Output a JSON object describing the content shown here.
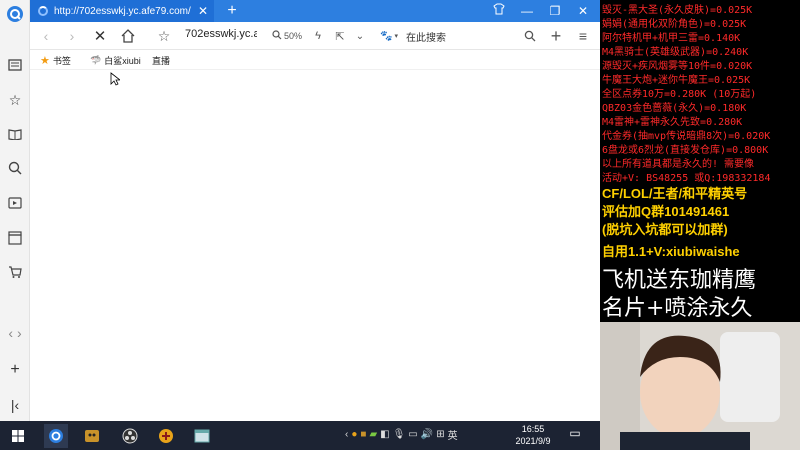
{
  "browser": {
    "tab": {
      "title": "http://702esswkj.yc.afe79.com/"
    },
    "address_text": "702esswkj.yc.a",
    "zoom_level": "50%",
    "search_placeholder": "在此搜索",
    "bookmarks": {
      "label": "书签",
      "items": [
        "白鲨xiubi",
        "直播"
      ]
    }
  },
  "taskbar": {
    "time": "16:55",
    "date": "2021/9/9",
    "ime": "英"
  },
  "overlay": {
    "price_lines": [
      "毁灭-黑大圣(永久皮肤)=0.025K",
      "娟娟(通用化双阶角色)=0.025K",
      "阿尔特机甲+机甲三雷=0.140K",
      "M4黑骑士(英雄级武器)=0.240K",
      "源毁灭+疾风烟雾等10件=0.020K",
      "牛魔王大炮+迷你牛魔王=0.025K",
      "全区点券10万=0.280K (10万起)",
      "QBZ03金色蔷薇(永久)=0.180K",
      "M4雷神+雷神永久先致=0.280K",
      "代金券(抽mvp传说暗鼎8次)=0.020K",
      "6盘龙或6烈龙(直接发仓库)=0.800K",
      "以上所有道具都是永久的! 需要像",
      "活动+V: BS48255   或Q:198332184"
    ],
    "promo_lines": [
      "CF/LOL/王者/和平精英号",
      "评估加Q群101491461",
      "(脱坑入坑都可以加群)"
    ],
    "contact": "自用1.1+V:xiubiwaishe",
    "big_lines": [
      "飞机送东珈精鹰",
      "名片+喷涂永久"
    ]
  }
}
